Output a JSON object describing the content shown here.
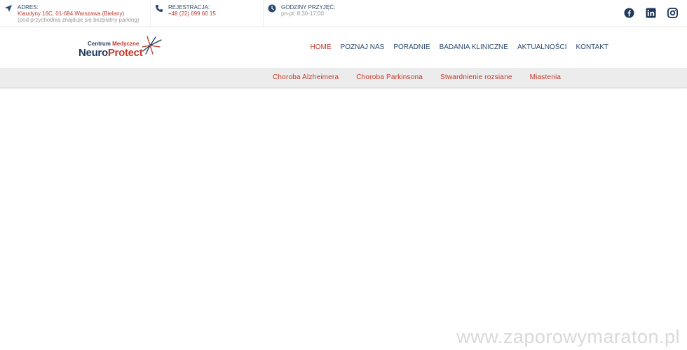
{
  "topbar": {
    "address": {
      "label": "ADRES:",
      "value": "Klaudyny 16C, 01-684 Warszawa (Bielany)",
      "sub": "(pod przychodnią znajduje się bezpłatny parking)"
    },
    "registration": {
      "label": "REJESTRACJA:",
      "value": "+48 (22) 699 60 15"
    },
    "hours": {
      "label": "GODZINY PRZYJĘĆ:",
      "value": "pn-pt: 8:30-17:00"
    },
    "socials": [
      "facebook-icon",
      "linkedin-icon",
      "instagram-icon"
    ]
  },
  "logo": {
    "small_a": "Centrum ",
    "small_b": "Medyczne",
    "big_a": "Neuro",
    "big_b": "Protect"
  },
  "nav": {
    "items": [
      {
        "label": "HOME"
      },
      {
        "label": "POZNAJ NAS"
      },
      {
        "label": "PORADNIE"
      },
      {
        "label": "BADANIA KLINICZNE"
      },
      {
        "label": "AKTUALNOŚCI"
      },
      {
        "label": "KONTAKT"
      }
    ]
  },
  "subnav": {
    "items": [
      {
        "label": "Choroba Alzheimera"
      },
      {
        "label": "Choroba Parkinsona"
      },
      {
        "label": "Stwardnienie rozsiane"
      },
      {
        "label": "Miastenia"
      }
    ]
  },
  "watermark": "www.zaporowymaraton.pl",
  "colors": {
    "accent": "#c0392b",
    "navy": "#2b4a6b",
    "subnav_bg": "#ececec"
  }
}
